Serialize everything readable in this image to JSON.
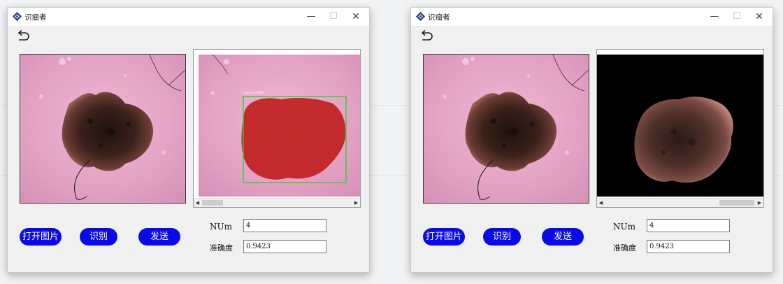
{
  "window_left": {
    "title": "识瘤者",
    "buttons": {
      "open": "打开图片",
      "recognize": "识别",
      "send": "发送"
    },
    "fields": {
      "num_label": "NUm",
      "num_value": "4",
      "accuracy_label": "准确度",
      "accuracy_value": "0.9423"
    },
    "detection_tag": "0 pixel 0.9423"
  },
  "window_right": {
    "title": "识瘤者",
    "buttons": {
      "open": "打开图片",
      "recognize": "识别",
      "send": "发送"
    },
    "fields": {
      "num_label": "NUm",
      "num_value": "4",
      "accuracy_label": "准确度",
      "accuracy_value": "0.9423"
    }
  },
  "colors": {
    "accent_button": "#0a0ae6",
    "detection_box": "#2fd12f",
    "mask_fill": "#c01f1f",
    "skin": "#e6a6c8"
  },
  "icons": [
    "app-logo-icon",
    "minimize-icon",
    "maximize-icon",
    "close-icon",
    "back-arrow-icon",
    "scroll-left-icon",
    "scroll-right-icon"
  ]
}
